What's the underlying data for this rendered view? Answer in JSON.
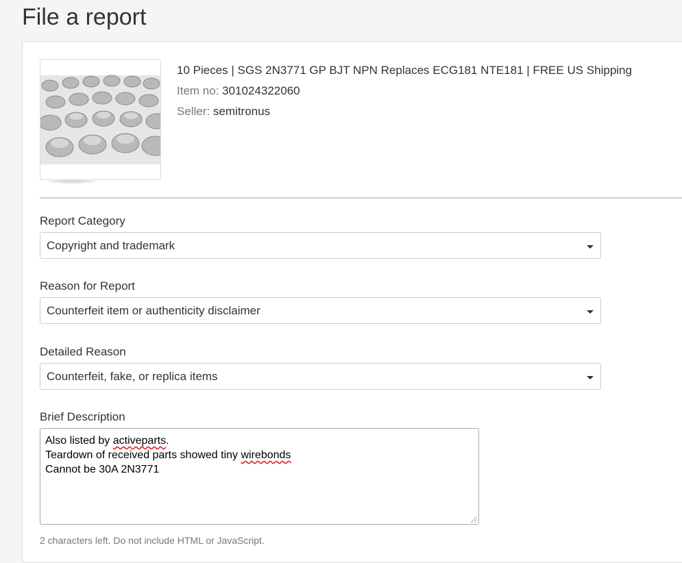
{
  "page": {
    "title": "File a report"
  },
  "item": {
    "image_alt": "Product photo of metal-can transistors",
    "title": "10 Pieces | SGS 2N3771 GP BJT NPN Replaces ECG181 NTE181 | FREE US Shipping",
    "item_no_label": "Item no:",
    "item_no": "301024322060",
    "seller_label": "Seller:",
    "seller": "semitronus"
  },
  "form": {
    "category": {
      "label": "Report Category",
      "value": "Copyright and trademark"
    },
    "reason": {
      "label": "Reason for Report",
      "value": "Counterfeit item or authenticity disclaimer"
    },
    "detailed": {
      "label": "Detailed Reason",
      "value": "Counterfeit, fake, or replica items"
    },
    "description": {
      "label": "Brief Description",
      "line1_prefix": "Also listed by ",
      "line1_word": "activeparts",
      "line1_suffix": ".",
      "line2_prefix": "Teardown of received parts showed tiny ",
      "line2_word": "wirebonds",
      "line3": "Cannot be 30A  2N3771"
    },
    "help_text": "2 characters left. Do not include HTML or JavaScript."
  },
  "icons": {
    "dropdown": "chevron-down-icon",
    "resize": "resize-grip-icon"
  }
}
